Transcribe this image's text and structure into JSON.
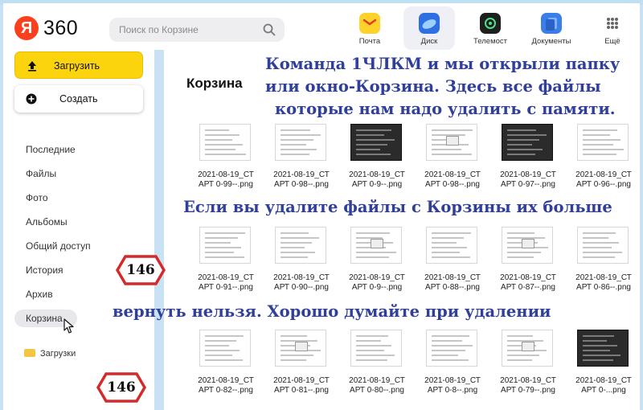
{
  "header": {
    "logo_letter": "Я",
    "logo_text": "360",
    "search_placeholder": "Поиск по Корзине",
    "apps": [
      {
        "label": "Почта",
        "icon": "mail-icon",
        "color": "#fdd22b"
      },
      {
        "label": "Диск",
        "icon": "disk-icon",
        "color": "#2f6fe4",
        "active": true
      },
      {
        "label": "Телемост",
        "icon": "telemost-icon",
        "color": "#1f1f1f"
      },
      {
        "label": "Документы",
        "icon": "documents-icon",
        "color": "#3c7ee8"
      },
      {
        "label": "Ещё",
        "icon": "more-icon",
        "color": "#777777"
      }
    ]
  },
  "sidebar": {
    "upload_label": "Загрузить",
    "create_label": "Создать",
    "nav": [
      "Последние",
      "Файлы",
      "Фото",
      "Альбомы",
      "Общий доступ",
      "История",
      "Архив",
      "Корзина"
    ],
    "active_nav": "Корзина",
    "folder_label": "Загрузки"
  },
  "main": {
    "title": "Корзина",
    "files": [
      [
        "2021-08-19_СТ",
        "АРТ 0-99--.png"
      ],
      [
        "2021-08-19_СТ",
        "АРТ 0-98--.png"
      ],
      [
        "2021-08-19_СТ",
        "АРТ 0-9--.png"
      ],
      [
        "2021-08-19_СТ",
        "АРТ 0-98--.png"
      ],
      [
        "2021-08-19_СТ",
        "АРТ 0-97--.png"
      ],
      [
        "2021-08-19_СТ",
        "АРТ 0-96--.png"
      ],
      [
        "2021-08-19_СТ",
        "АРТ 0-91--.png"
      ],
      [
        "2021-08-19_СТ",
        "АРТ 0-90--.png"
      ],
      [
        "2021-08-19_СТ",
        "АРТ 0-9--.png"
      ],
      [
        "2021-08-19_СТ",
        "АРТ 0-88--.png"
      ],
      [
        "2021-08-19_СТ",
        "АРТ 0-87--.png"
      ],
      [
        "2021-08-19_СТ",
        "АРТ 0-86--.png"
      ],
      [
        "2021-08-19_СТ",
        "АРТ 0-82--.png"
      ],
      [
        "2021-08-19_СТ",
        "АРТ 0-81--.png"
      ],
      [
        "2021-08-19_СТ",
        "АРТ 0-80--.png"
      ],
      [
        "2021-08-19_СТ",
        "АРТ 0-8--.png"
      ],
      [
        "2021-08-19_СТ",
        "АРТ 0-79--.png"
      ],
      [
        "2021-08-19_СТ",
        "АРТ 0-...png"
      ]
    ]
  },
  "annotations": {
    "note1": [
      "Команда 1ЧЛКМ и мы открыли папку",
      "или окно-Корзина. Здесь все файлы",
      "которые нам надо удалить с памяти."
    ],
    "note2": "Если вы удалите файлы с Корзины их больше",
    "note3": "вернуть нельзя. Хорошо думайте при удалении",
    "badge1": "146",
    "badge2": "146",
    "note_color": "#2f3f9a",
    "badge_color": "#d42a2a"
  }
}
